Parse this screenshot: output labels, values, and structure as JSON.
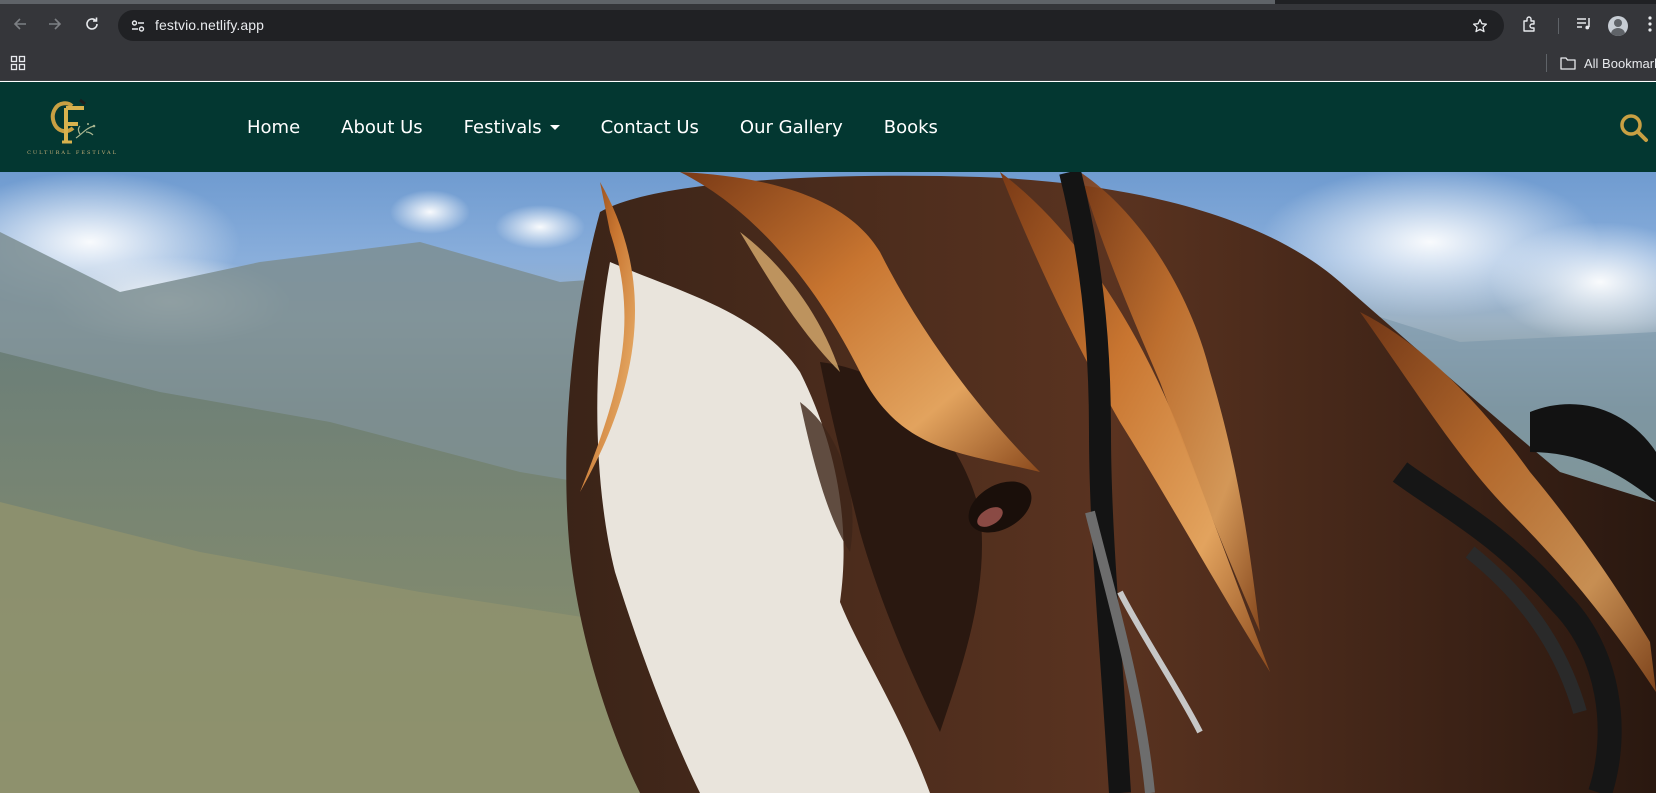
{
  "browser": {
    "url": "festvio.netlify.app",
    "bookmarks_label": "All Bookmarks",
    "icons": [
      "back-icon",
      "forward-icon",
      "reload-icon",
      "site-info-icon",
      "star-icon",
      "extensions-icon",
      "media-icon",
      "profile-avatar",
      "menu-icon",
      "apps-icon",
      "folder-icon"
    ]
  },
  "site": {
    "logo_text": "CULTURAL FESTIVAL",
    "nav": [
      {
        "label": "Home"
      },
      {
        "label": "About Us"
      },
      {
        "label": "Festivals",
        "dropdown": true
      },
      {
        "label": "Contact Us"
      },
      {
        "label": "Our Gallery"
      },
      {
        "label": "Books"
      }
    ],
    "colors": {
      "nav_bg": "#033731",
      "accent_gold": "#c9a043",
      "nav_text": "#ffffff"
    },
    "hero": {
      "subject": "close-up of a brown and white horse with a flowing auburn mane and bridle, mountain valley and blue sky behind"
    }
  }
}
